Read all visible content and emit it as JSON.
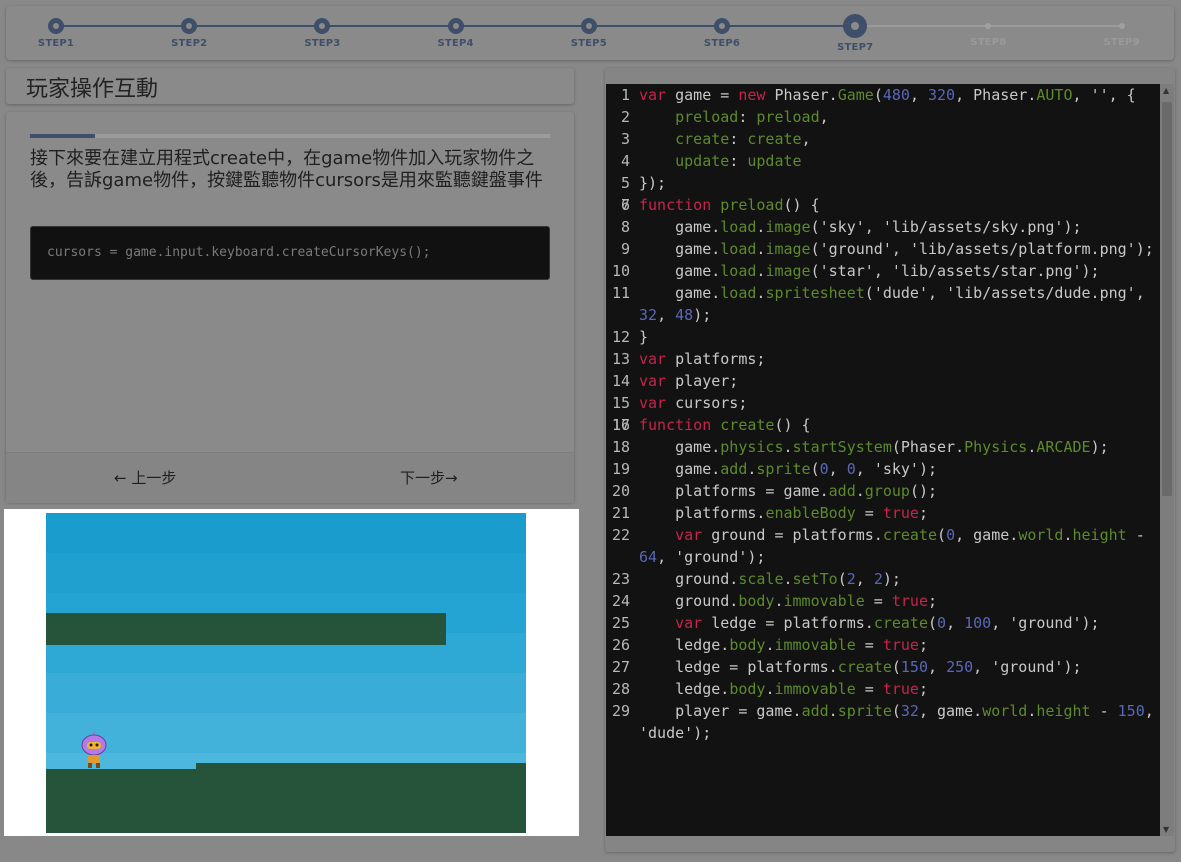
{
  "stepper": {
    "steps": [
      {
        "label": "STEP1",
        "state": "done"
      },
      {
        "label": "STEP2",
        "state": "done"
      },
      {
        "label": "STEP3",
        "state": "done"
      },
      {
        "label": "STEP4",
        "state": "done"
      },
      {
        "label": "STEP5",
        "state": "done"
      },
      {
        "label": "STEP6",
        "state": "done"
      },
      {
        "label": "STEP7",
        "state": "current"
      },
      {
        "label": "STEP8",
        "state": "future"
      },
      {
        "label": "STEP9",
        "state": "future"
      }
    ]
  },
  "lesson": {
    "title": "玩家操作互動",
    "progress": 0.125,
    "instruction": "接下來要在建立用程式create中，在game物件加入玩家物件之後，告訴game物件，按鍵監聽物件cursors是用來監聽鍵盤事件",
    "code_snippet": "cursors = game.input.keyboard.createCursorKeys();",
    "prev_label": "← 上一步",
    "next_label": "下一步→"
  },
  "editor": {
    "lines": [
      {
        "n": "1",
        "code": "var game = new Phaser.Game(480, 320, Phaser.AUTO, '', {"
      },
      {
        "n": "2",
        "code": "    preload: preload,"
      },
      {
        "n": "3",
        "code": "    create: create,"
      },
      {
        "n": "4",
        "code": "    update: update"
      },
      {
        "n": "5",
        "code": "});"
      },
      {
        "n": "6",
        "code": ""
      },
      {
        "n": "7",
        "code": "function preload() {"
      },
      {
        "n": "8",
        "code": "    game.load.image('sky', 'lib/assets/sky.png');"
      },
      {
        "n": "9",
        "code": "    game.load.image('ground', 'lib/assets/platform.png');"
      },
      {
        "n": "10",
        "code": "    game.load.image('star', 'lib/assets/star.png');"
      },
      {
        "n": "11",
        "code": "    game.load.spritesheet('dude', 'lib/assets/dude.png', 32, 48);"
      },
      {
        "n": "12",
        "code": "}"
      },
      {
        "n": "13",
        "code": "var platforms;"
      },
      {
        "n": "14",
        "code": "var player;"
      },
      {
        "n": "15",
        "code": "var cursors;"
      },
      {
        "n": "16",
        "code": ""
      },
      {
        "n": "17",
        "code": "function create() {"
      },
      {
        "n": "18",
        "code": "    game.physics.startSystem(Phaser.Physics.ARCADE);"
      },
      {
        "n": "19",
        "code": "    game.add.sprite(0, 0, 'sky');"
      },
      {
        "n": "20",
        "code": "    platforms = game.add.group();"
      },
      {
        "n": "21",
        "code": "    platforms.enableBody = true;"
      },
      {
        "n": "22",
        "code": "    var ground = platforms.create(0, game.world.height - 64, 'ground');"
      },
      {
        "n": "23",
        "code": "    ground.scale.setTo(2, 2);"
      },
      {
        "n": "24",
        "code": "    ground.body.immovable = true;"
      },
      {
        "n": "25",
        "code": "    var ledge = platforms.create(0, 100, 'ground');"
      },
      {
        "n": "26",
        "code": "    ledge.body.immovable = true;"
      },
      {
        "n": "27",
        "code": "    ledge = platforms.create(150, 250, 'ground');"
      },
      {
        "n": "28",
        "code": "    ledge.body.immovable = true;"
      },
      {
        "n": "29",
        "code": "    player = game.add.sprite(32, game.world.height - 150, 'dude');"
      }
    ]
  },
  "colors": {
    "accent": "#3f4f69",
    "sky": "#27a7d6",
    "ground": "#25543a",
    "editor_bg": "#121212",
    "keyword": "#c8234a"
  }
}
